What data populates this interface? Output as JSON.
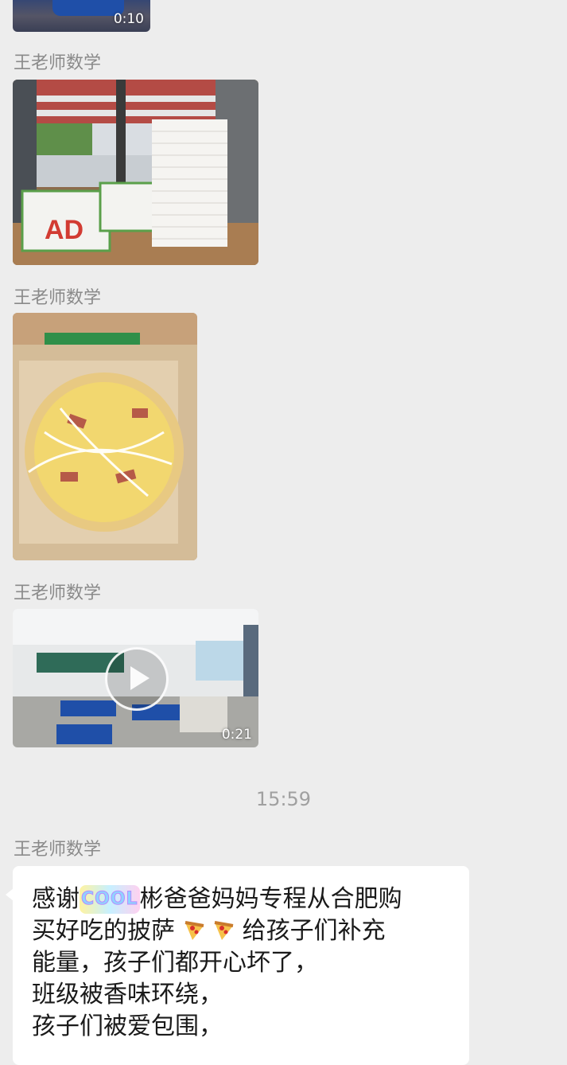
{
  "chat": {
    "top_video": {
      "duration": "0:10"
    },
    "messages": [
      {
        "sender": "王老师数学",
        "type": "image",
        "alt": "ADD饮料和披萨盒"
      },
      {
        "sender": "王老师数学",
        "type": "image",
        "alt": "披萨"
      },
      {
        "sender": "王老师数学",
        "type": "video",
        "duration": "0:21"
      }
    ],
    "timestamp": "15:59",
    "text_message": {
      "sender": "王老师数学",
      "line1_a": "感谢",
      "line1_sticker": "COOL",
      "line1_b": "彬爸爸妈妈专程从合肥购",
      "line2_a": "买好吃的披萨",
      "line2_b": "给孩子们补充",
      "line3": "能量，孩子们都开心坏了，",
      "line4": "班级被香味环绕，",
      "line5": "孩子们被爱包围，"
    }
  }
}
